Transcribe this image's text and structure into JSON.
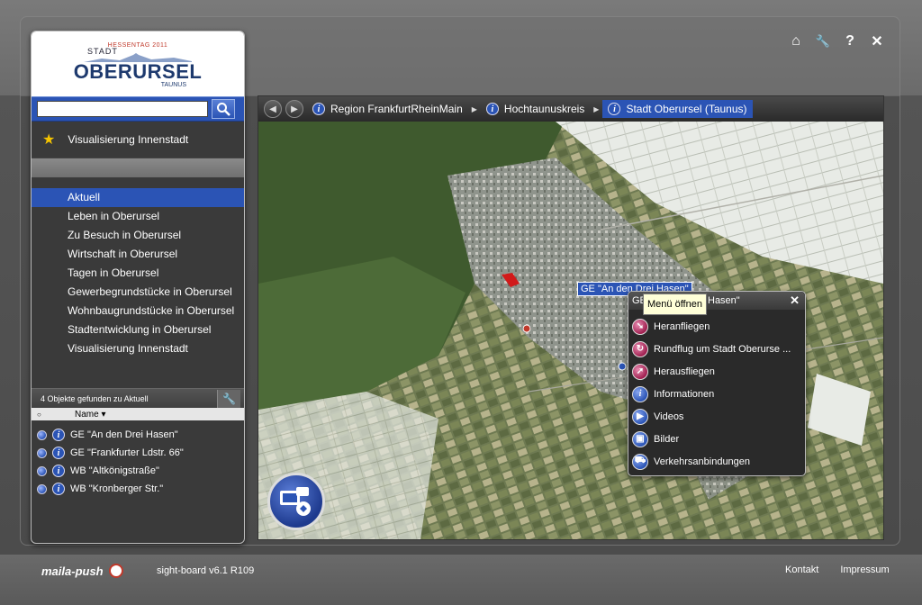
{
  "header": {
    "icons": [
      "home-icon",
      "wrench-icon",
      "help-icon",
      "close-icon"
    ],
    "icon_glyphs": {
      "home": "⌂",
      "wrench": "🔧",
      "help": "?",
      "close": "✕"
    }
  },
  "logo": {
    "hessentag": "HESSENTAG 2011",
    "stadt": "STADT",
    "name": "OBERURSEL",
    "taunus": "TAUNUS"
  },
  "search": {
    "value": "",
    "placeholder": ""
  },
  "favorite": {
    "label": "Visualisierung Innenstadt"
  },
  "menu": {
    "items": [
      {
        "label": "Aktuell",
        "active": true
      },
      {
        "label": "Leben in Oberursel"
      },
      {
        "label": "Zu Besuch in Oberursel"
      },
      {
        "label": "Wirtschaft in Oberursel"
      },
      {
        "label": "Tagen in Oberursel"
      },
      {
        "label": "Gewerbegrundstücke in Oberursel"
      },
      {
        "label": "Wohnbaugrundstücke in Oberursel"
      },
      {
        "label": "Stadtentwicklung in Oberursel"
      },
      {
        "label": "Visualisierung Innenstadt"
      }
    ]
  },
  "results": {
    "header": "4 Objekte gefunden zu Aktuell",
    "col_name": "Name",
    "rows": [
      {
        "label": "GE \"An den Drei Hasen\""
      },
      {
        "label": "GE \"Frankfurter Ldstr. 66\""
      },
      {
        "label": "WB \"Altkönigstraße\""
      },
      {
        "label": "WB \"Kronberger Str.\""
      }
    ]
  },
  "breadcrumb": {
    "items": [
      {
        "label": "Region FrankfurtRheinMain"
      },
      {
        "label": "Hochtaunuskreis"
      },
      {
        "label": "Stadt Oberursel (Taunus)",
        "active": true
      }
    ]
  },
  "map": {
    "label": "GE \"An den Drei Hasen\"",
    "popup": {
      "title": "GE \"An den Drei Hasen\"",
      "tooltip": "Menü öffnen",
      "items": [
        {
          "label": "Heranfliegen",
          "icon": "fly-in-icon"
        },
        {
          "label": "Rundflug um Stadt Oberurse ...",
          "icon": "orbit-icon"
        },
        {
          "label": "Herausfliegen",
          "icon": "fly-out-icon"
        },
        {
          "label": "Informationen",
          "icon": "info-icon"
        },
        {
          "label": "Videos",
          "icon": "video-icon"
        },
        {
          "label": "Bilder",
          "icon": "image-icon"
        },
        {
          "label": "Verkehrsanbindungen",
          "icon": "car-icon"
        }
      ]
    }
  },
  "footer": {
    "brand": "maila-push",
    "version": "sight-board v6.1 R109",
    "contact": "Kontakt",
    "imprint": "Impressum"
  },
  "colors": {
    "accent": "#2b54b5",
    "background": "#5d5d5d",
    "panel": "#3a3a3a"
  }
}
